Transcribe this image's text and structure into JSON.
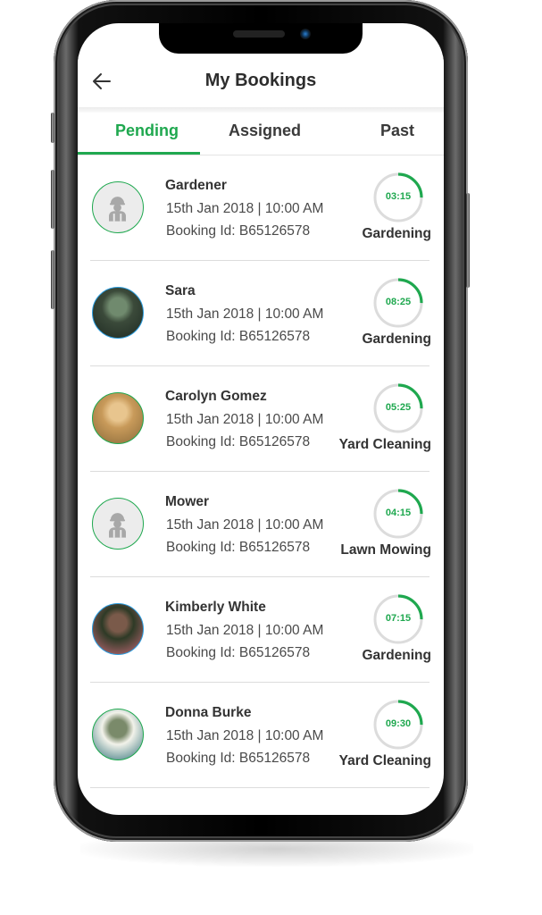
{
  "header": {
    "title": "My Bookings",
    "back_icon": "arrow-left-icon"
  },
  "tabs": [
    {
      "label": "Pending",
      "active": true
    },
    {
      "label": "Assigned",
      "active": false
    },
    {
      "label": "Past",
      "active": false
    }
  ],
  "colors": {
    "accent": "#1fa84f",
    "ring_track": "#dcdcdc",
    "avatar_border_blue": "#2c9ee0"
  },
  "bookings": [
    {
      "name": "Gardener",
      "datetime": "15th Jan 2018 | 10:00 AM",
      "booking_id": "Booking Id: B65126578",
      "timer": "03:15",
      "service": "Gardening",
      "avatar": "worker-placeholder-icon",
      "border": "green"
    },
    {
      "name": "Sara",
      "datetime": "15th Jan 2018 | 10:00 AM",
      "booking_id": "Booking Id: B65126578",
      "timer": "08:25",
      "service": "Gardening",
      "avatar": "photo",
      "border": "blue"
    },
    {
      "name": "Carolyn Gomez",
      "datetime": "15th Jan 2018 | 10:00 AM",
      "booking_id": "Booking Id: B65126578",
      "timer": "05:25",
      "service": "Yard Cleaning",
      "avatar": "photo",
      "border": "green"
    },
    {
      "name": "Mower",
      "datetime": "15th Jan 2018 | 10:00 AM",
      "booking_id": "Booking Id: B65126578",
      "timer": "04:15",
      "service": "Lawn Mowing",
      "avatar": "worker-placeholder-icon",
      "border": "green"
    },
    {
      "name": "Kimberly White",
      "datetime": "15th Jan 2018 | 10:00 AM",
      "booking_id": "Booking Id: B65126578",
      "timer": "07:15",
      "service": "Gardening",
      "avatar": "photo",
      "border": "blue"
    },
    {
      "name": "Donna Burke",
      "datetime": "15th Jan 2018 | 10:00 AM",
      "booking_id": "Booking Id: B65126578",
      "timer": "09:30",
      "service": "Yard Cleaning",
      "avatar": "photo",
      "border": "green"
    }
  ],
  "timer_progress_fraction": 0.25
}
